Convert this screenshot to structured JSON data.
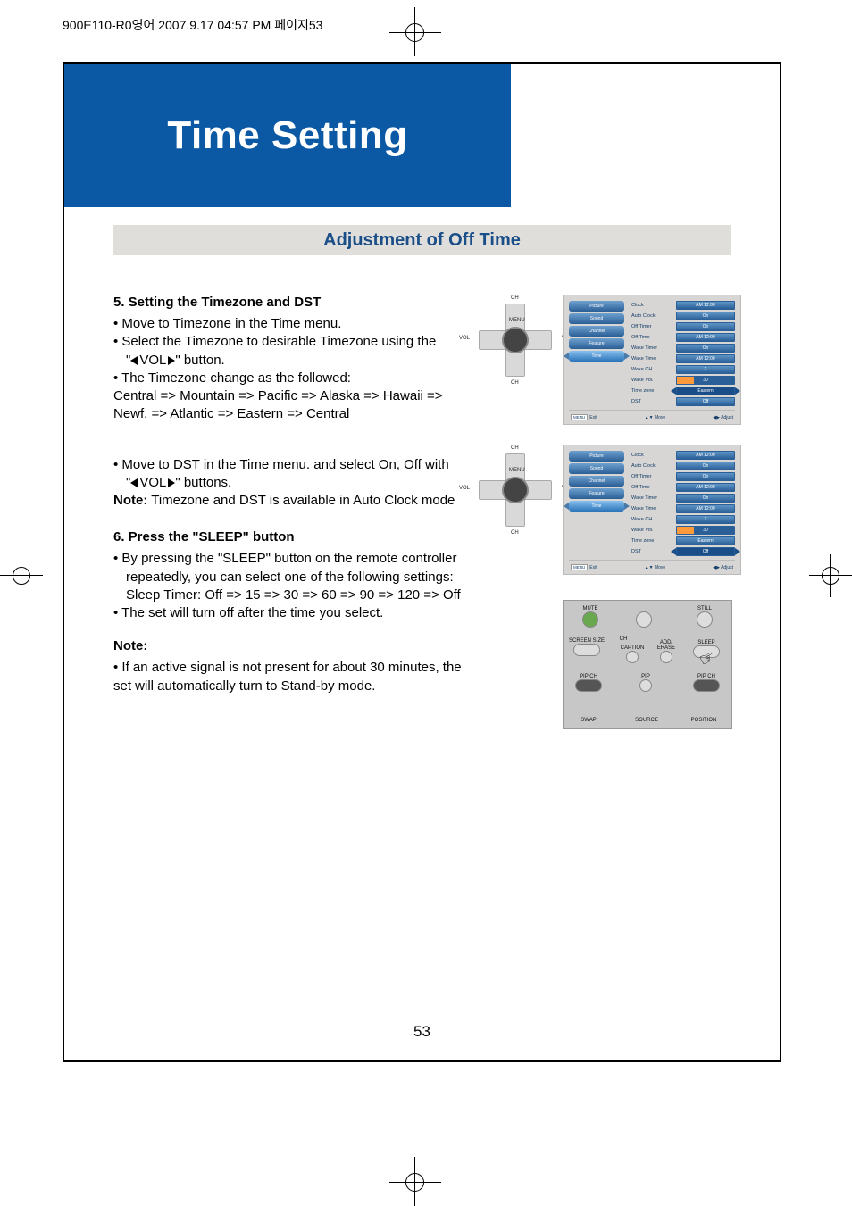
{
  "print_header": "900E110-R0영어  2007.9.17 04:57 PM  페이지53",
  "title": "Time Setting",
  "section": "Adjustment of Off Time",
  "step5": {
    "heading": "5. Setting the Timezone and DST",
    "b1": "• Move to Timezone in the Time menu.",
    "b2a": "• Select the Timezone to desirable Timezone using the",
    "b2b_prefix": "\"",
    "b2b_vol": "VOL",
    "b2b_suffix": "\" button.",
    "b3": "• The Timezone change as the followed:",
    "cycle1": "Central => Mountain => Pacific => Alaska => Hawaii =>",
    "cycle2": "Newf. => Atlantic => Eastern => Central",
    "dst1": "• Move to DST in the Time menu. and select On, Off with",
    "dst2_prefix": "\"",
    "dst2_vol": "VOL",
    "dst2_suffix": "\" buttons.",
    "note_label": "Note:",
    "note_text": " Timezone and DST is available in Auto Clock mode"
  },
  "step6": {
    "heading": "6. Press the \"SLEEP\" button",
    "b1a": "• By pressing the \"SLEEP\" button on the remote controller",
    "b1b": "repeatedly, you can select one of the following settings:",
    "b1c": "Sleep Timer: Off => 15  => 30 => 60 => 90 => 120 => Off",
    "b2": "• The set will turn off after the time you select.",
    "note_label": "Note:",
    "n1": "• If an active signal is not present for about 30 minutes, the",
    "n2": "set will automatically turn to Stand-by mode."
  },
  "dpad": {
    "ch": "CH",
    "vol": "VOL",
    "menu": "MENU"
  },
  "osd": {
    "tabs": [
      "Picture",
      "Sound",
      "Channel",
      "Feature",
      "Time"
    ],
    "rows": [
      {
        "k": "Clock",
        "v": "AM 12:00"
      },
      {
        "k": "Auto Clock",
        "v": "On"
      },
      {
        "k": "Off Timer",
        "v": "On"
      },
      {
        "k": "Off Time",
        "v": "AM 12:00"
      },
      {
        "k": "Wake Timer",
        "v": "On"
      },
      {
        "k": "Wake Time",
        "v": "AM 12:00"
      },
      {
        "k": "Wake CH.",
        "v": "2"
      },
      {
        "k": "Wake Vol.",
        "v": "30"
      },
      {
        "k": "Time zone",
        "v": "Eastern"
      },
      {
        "k": "DST",
        "v": "Off"
      }
    ],
    "highlight_a_index": 8,
    "highlight_b_index": 9,
    "footer": {
      "exit_chip": "MENU",
      "exit": "Exit",
      "move": "Move",
      "adjust": "Adjust"
    }
  },
  "remote": {
    "mute": "MUTE",
    "still": "STILL",
    "screen_size": "SCREEN SIZE",
    "ch": "CH",
    "caption": "CAPTION",
    "add_erase": "ADD/ ERASE",
    "sleep": "SLEEP",
    "pip_ch_l": "PIP CH",
    "pip": "PIP",
    "pip_ch_r": "PIP CH",
    "swap": "SWAP",
    "source": "SOURCE",
    "position": "POSITION"
  },
  "page_number": "53"
}
